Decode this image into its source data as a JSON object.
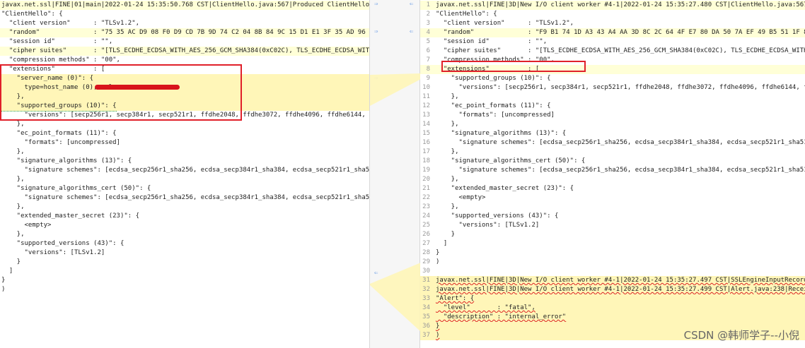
{
  "left": {
    "lines": [
      "javax.net.ssl|FINE|01|main|2022-01-24 15:35:50.768 CST|ClientHello.java:567|Produced ClientHello handshake message (",
      "\"ClientHello\": {",
      "  \"client version\"      : \"TLSv1.2\",",
      "  \"random\"              : \"75 35 AC D9 08 F0 D9 CD 7B 9D 74 C2 04 8B 84 9C 15 D1 E1 3F 35 AD 96 21 3E 88 93 C5 77 70 D4 D0\"",
      "  \"session id\"          : \"\",",
      "  \"cipher suites\"       : \"[TLS_ECDHE_ECDSA_WITH_AES_256_GCM_SHA384(0xC02C), TLS_ECDHE_ECDSA_WITH_AES_128_GCM_SHA256(0xC02B",
      "  \"compression methods\" : \"00\",",
      "  \"extensions\"          : [",
      "    \"server_name (0)\": {",
      "      type=host_name (0), value=",
      "    },",
      "    \"supported_groups (10)\": {",
      "      \"versions\": [secp256r1, secp384r1, secp521r1, ffdhe2048, ffdhe3072, ffdhe4096, ffdhe6144, ffdhe8192]",
      "    },",
      "    \"ec_point_formats (11)\": {",
      "      \"formats\": [uncompressed]",
      "    },",
      "    \"signature_algorithms (13)\": {",
      "      \"signature schemes\": [ecdsa_secp256r1_sha256, ecdsa_secp384r1_sha384, ecdsa_secp521r1_sha512, rsa_pss_rsae_sha256, rs",
      "    },",
      "    \"signature_algorithms_cert (50)\": {",
      "      \"signature schemes\": [ecdsa_secp256r1_sha256, ecdsa_secp384r1_sha384, ecdsa_secp521r1_sha512, rsa_pss_rsae_sha256, rs",
      "    },",
      "    \"extended_master_secret (23)\": {",
      "      <empty>",
      "    },",
      "    \"supported_versions (43)\": {",
      "      \"versions\": [TLSv1.2]",
      "    }",
      "  ]",
      "}",
      ")"
    ]
  },
  "right": {
    "lines": [
      "javax.net.ssl|FINE|3D|New I/O client worker #4-1|2022-01-24 15:35:27.480 CST|ClientHello.java:567|Produced ClientHello hand",
      "\"ClientHello\": {",
      "  \"client version\"      : \"TLSv1.2\",",
      "  \"random\"              : \"F9 B1 74 1D A3 43 A4 AA 3D 8C 2C 64 4F E7 80 DA 50 7A EF 49 B5 51 1F 80 89 A8 6A 8E 4B B2 1B 1C\"",
      "  \"session id\"          : \"\",",
      "  \"cipher suites\"       : \"[TLS_ECDHE_ECDSA_WITH_AES_256_GCM_SHA384(0xC02C), TLS_ECDHE_ECDSA_WITH_AES_128_GCM_SHA256(0xC02B",
      "  \"compression methods\" : \"00\",",
      "  \"extensions\"          : [",
      "    \"supported_groups (10)\": {",
      "      \"versions\": [secp256r1, secp384r1, secp521r1, ffdhe2048, ffdhe3072, ffdhe4096, ffdhe6144, ffdhe8192]",
      "    },",
      "    \"ec_point_formats (11)\": {",
      "      \"formats\": [uncompressed]",
      "    },",
      "    \"signature_algorithms (13)\": {",
      "      \"signature schemes\": [ecdsa_secp256r1_sha256, ecdsa_secp384r1_sha384, ecdsa_secp521r1_sha512, rsa_pss_rsae_sha256, rs",
      "    },",
      "    \"signature_algorithms_cert (50)\": {",
      "      \"signature schemes\": [ecdsa_secp256r1_sha256, ecdsa_secp384r1_sha384, ecdsa_secp521r1_sha512, rsa_pss_rsae_sha256, rs",
      "    },",
      "    \"extended_master_secret (23)\": {",
      "      <empty>",
      "    },",
      "    \"supported_versions (43)\": {",
      "      \"versions\": [TLSv1.2]",
      "    }",
      "  ]",
      "}",
      ")",
      "",
      "javax.net.ssl|FINE|3D|New I/O client worker #4-1|2022-01-24 15:35:27.497 CST|SSLEngineInputRecord.java:214|READ: TLSv1.2 al",
      "javax.net.ssl|FINE|3D|New I/O client worker #4-1|2022-01-24 15:35:27.499 CST|Alert.java:238|Received alert message (",
      "\"Alert\": {",
      "  \"level\"       : \"fatal\",",
      "  \"description\" : \"internal_error\"",
      "}",
      ")"
    ],
    "line_numbers": [
      "1",
      "2",
      "3",
      "4",
      "5",
      "6",
      "7",
      "8",
      "9",
      "10",
      "11",
      "12",
      "13",
      "14",
      "15",
      "16",
      "17",
      "18",
      "19",
      "20",
      "21",
      "22",
      "23",
      "24",
      "25",
      "26",
      "27",
      "28",
      "29",
      "30",
      "31",
      "32",
      "33",
      "34",
      "35",
      "36",
      "37"
    ]
  },
  "watermark": "CSDN @韩师学子--小倪"
}
